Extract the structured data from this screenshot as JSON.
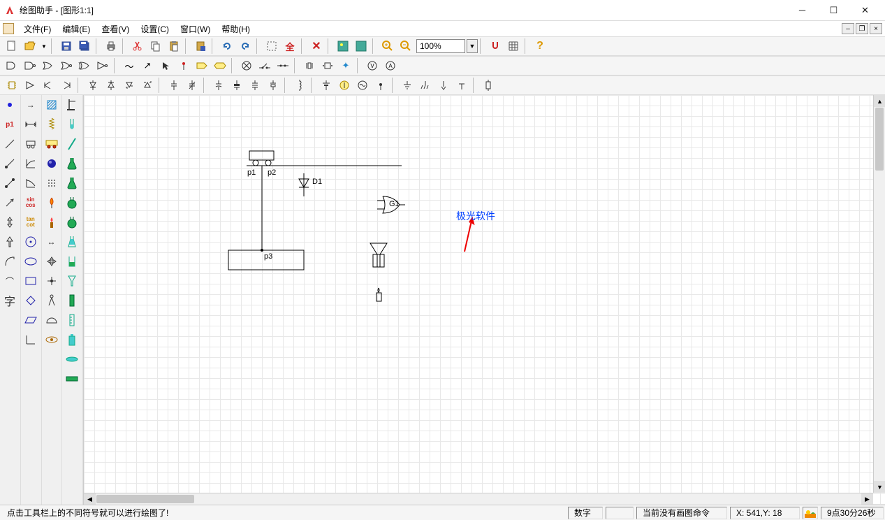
{
  "titlebar": {
    "title": "绘图助手 - [图形1:1]"
  },
  "menu": {
    "items": [
      "文件(F)",
      "编辑(E)",
      "查看(V)",
      "设置(C)",
      "窗口(W)",
      "帮助(H)"
    ]
  },
  "toolbar1": {
    "zoom": "100%"
  },
  "canvas": {
    "labels": {
      "p1": "p1",
      "p2": "p2",
      "p3": "p3",
      "D1": "D1",
      "G1": "G1"
    },
    "watermark": "极光软件"
  },
  "statusbar": {
    "hint": "点击工具栏上的不同符号就可以进行绘图了!",
    "numlock": "数字",
    "cmd": "当前没有画图命令",
    "coords": "X: 541,Y:  18",
    "time": "9点30分26秒"
  }
}
